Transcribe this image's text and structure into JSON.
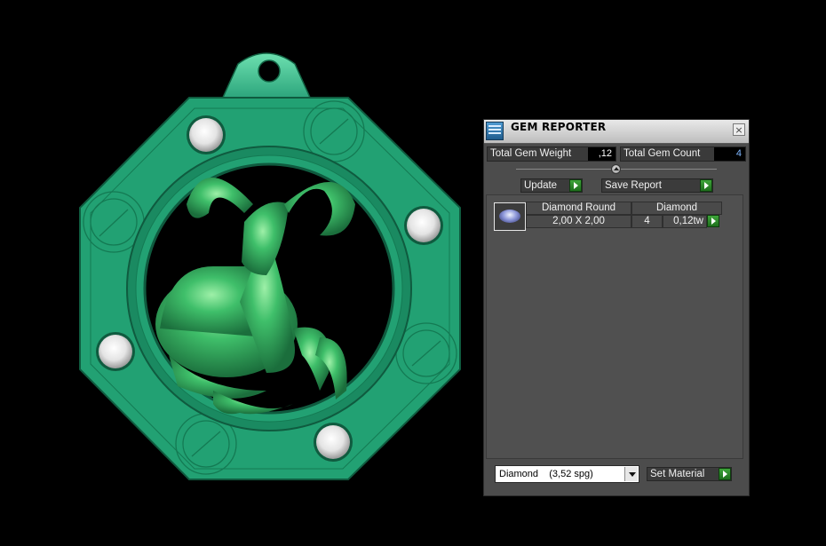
{
  "panel": {
    "title": "GEM REPORTER",
    "close_glyph": "×",
    "total_weight_label": "Total Gem Weight",
    "total_weight_value": ",12",
    "total_count_label": "Total Gem Count",
    "total_count_value": "4",
    "update_label": "Update",
    "save_report_label": "Save Report",
    "gem_row": {
      "shape": "Diamond Round",
      "material": "Diamond",
      "size": "2,00 X 2,00",
      "count": "4",
      "weight": "0,12tw"
    },
    "material_select": "Diamond    (3,52 spg)",
    "set_material_label": "Set Material"
  },
  "icons": {
    "title_icon": "gem-reporter-icon",
    "close": "close-icon",
    "arrow": "play-arrow-icon",
    "dropdown": "chevron-down-icon"
  },
  "colors": {
    "pendant": "#1f9a6b",
    "ram": "#3fbf6f",
    "accent_green": "#2c8f2a",
    "panel_bg": "#4c4c4c"
  }
}
